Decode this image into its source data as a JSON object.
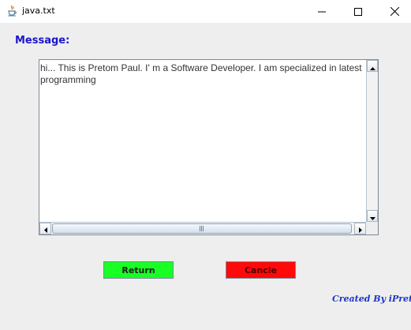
{
  "window": {
    "title": "java.txt",
    "icon": "java-cup-icon",
    "controls": {
      "minimize_icon": "minimize-icon",
      "maximize_icon": "maximize-icon",
      "close_icon": "close-icon"
    }
  },
  "message": {
    "label": "Message:",
    "text_lines": [
      "hi... This is Pretom Paul. I' m a Software Developer. I am specialized in latest",
      "programming"
    ]
  },
  "buttons": {
    "return_label": "Return",
    "cancel_label": "Cancle",
    "return_color": "#19ff26",
    "cancel_color": "#ff0a0a"
  },
  "footer": {
    "credit": "Created By iPretom"
  },
  "colors": {
    "label_blue": "#1c15c9",
    "credit_blue": "#1c35c9",
    "window_bg": "#eeeeee"
  }
}
